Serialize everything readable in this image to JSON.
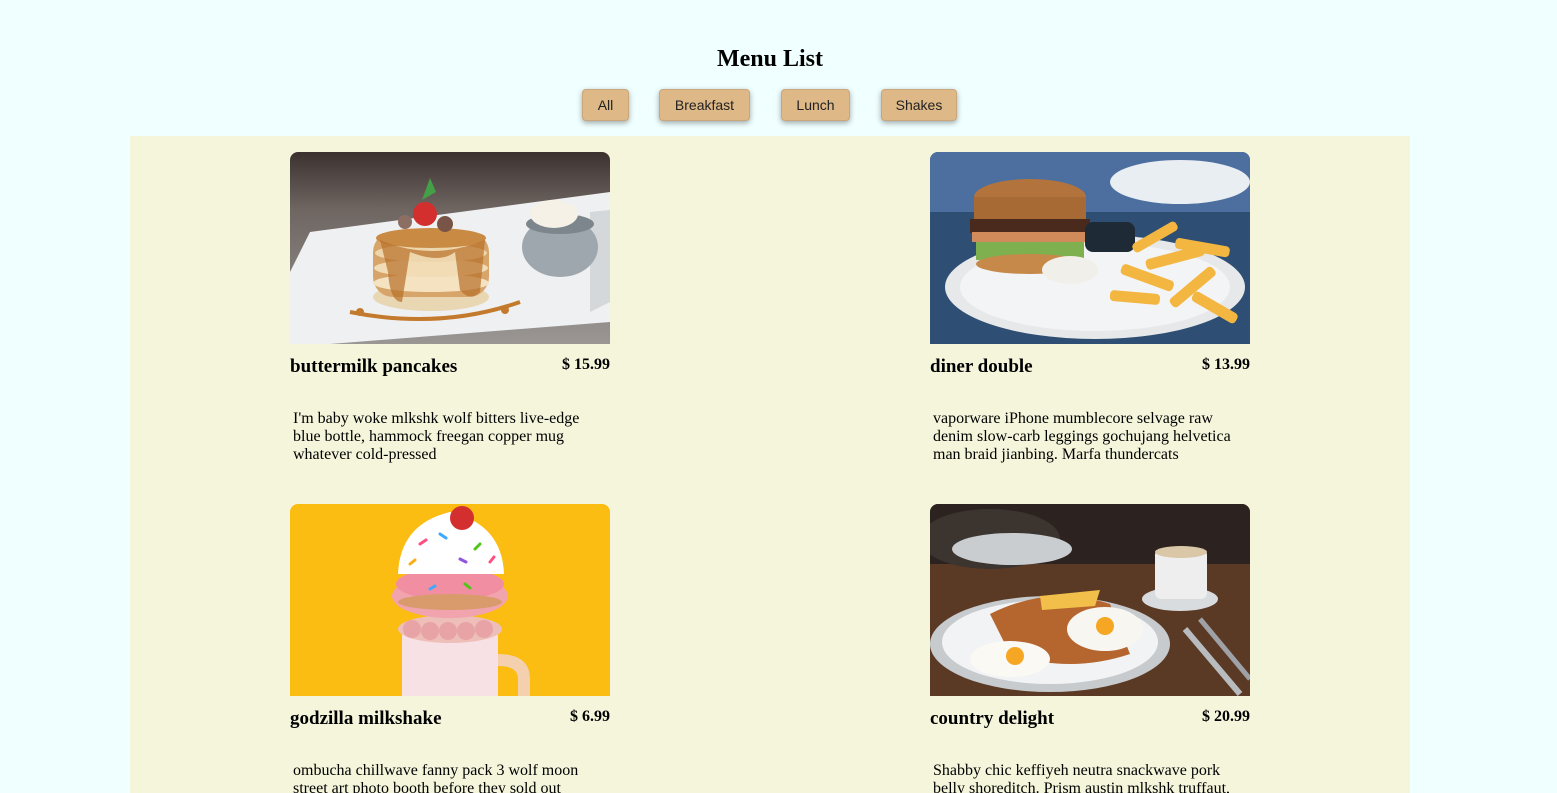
{
  "page_title": "Menu List",
  "filters": [
    {
      "label": "All"
    },
    {
      "label": "Breakfast"
    },
    {
      "label": "Lunch"
    },
    {
      "label": "Shakes"
    }
  ],
  "menu": [
    {
      "name": "buttermilk pancakes",
      "price": "$ 15.99",
      "desc": "I'm baby woke mlkshk wolf bitters live-edge blue bottle, hammock freegan copper mug whatever cold-pressed",
      "image": "pancakes-photo"
    },
    {
      "name": "diner double",
      "price": "$ 13.99",
      "desc": "vaporware iPhone mumblecore selvage raw denim slow-carb leggings gochujang helvetica man braid jianbing. Marfa thundercats",
      "image": "burger-photo"
    },
    {
      "name": "godzilla milkshake",
      "price": "$ 6.99",
      "desc": "ombucha chillwave fanny pack 3 wolf moon street art photo booth before they sold out",
      "image": "milkshake-photo"
    },
    {
      "name": "country delight",
      "price": "$ 20.99",
      "desc": "Shabby chic keffiyeh neutra snackwave pork belly shoreditch. Prism austin mlkshk truffaut,",
      "image": "breakfast-photo"
    }
  ],
  "colors": {
    "page_bg": "#f0ffff",
    "menu_bg": "#f5f5dc",
    "button_bg": "#deb887"
  }
}
